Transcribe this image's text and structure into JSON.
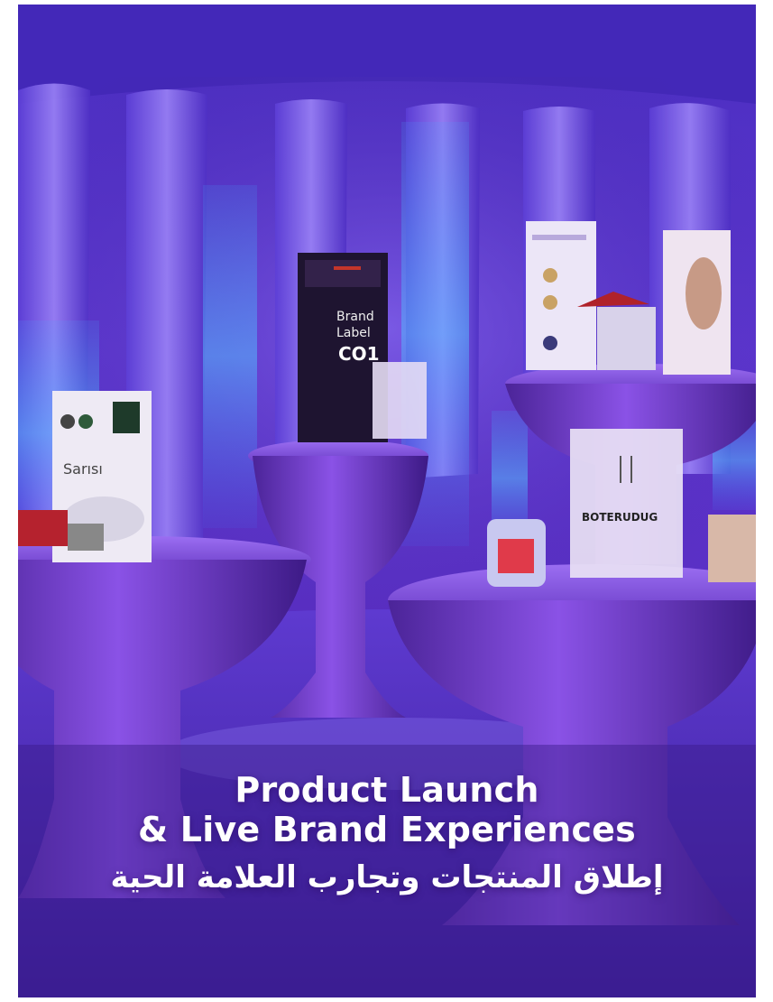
{
  "hero": {
    "title_line1": "Product Launch",
    "title_line2": "& Live Brand Experiences",
    "title_arabic": "إطلاق المنتجات وتجارب العلامة الحية"
  },
  "scene": {
    "left_display_text": "Sarısı",
    "center_box_text_1": "Brand",
    "center_box_text_2": "Label",
    "center_box_text_3": "CO1",
    "right_box_text": "BOTERUDUG"
  }
}
